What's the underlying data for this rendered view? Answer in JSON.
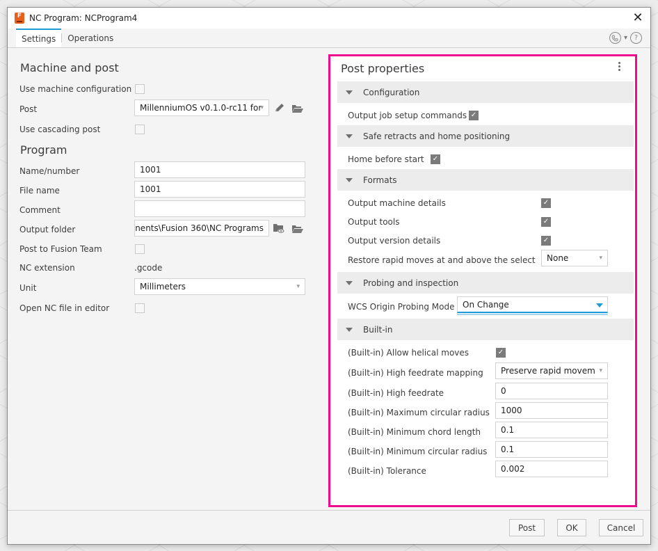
{
  "window": {
    "title": "NC Program: NCProgram4",
    "app_icon_letter": "F",
    "close_glyph": "✕"
  },
  "tabs": [
    {
      "label": "Settings",
      "active": true
    },
    {
      "label": "Operations",
      "active": false
    }
  ],
  "header_tools": {
    "contact_icon": "phone-icon",
    "chevron_glyph": "⌄",
    "help_glyph": "?"
  },
  "machine_and_post": {
    "title": "Machine and post",
    "use_machine_configuration": {
      "label": "Use machine configuration",
      "checked": false
    },
    "post": {
      "label": "Post",
      "value": "MillenniumOS v0.1.0-rc11 for"
    },
    "use_cascading_post": {
      "label": "Use cascading post",
      "checked": false
    }
  },
  "program": {
    "title": "Program",
    "name_number": {
      "label": "Name/number",
      "value": "1001"
    },
    "file_name": {
      "label": "File name",
      "value": "1001"
    },
    "comment": {
      "label": "Comment",
      "value": ""
    },
    "output_folder": {
      "label": "Output folder",
      "value": "nents\\Fusion 360\\NC Programs"
    },
    "post_to_fusion_team": {
      "label": "Post to Fusion Team",
      "checked": false
    },
    "nc_extension": {
      "label": "NC extension",
      "value": ".gcode"
    },
    "unit": {
      "label": "Unit",
      "value": "Millimeters"
    },
    "open_nc_file_in_editor": {
      "label": "Open NC file in editor",
      "checked": false
    }
  },
  "post_properties": {
    "title": "Post properties",
    "accent_color": "#ec0c8c",
    "groups": {
      "configuration": {
        "label": "Configuration",
        "output_job_setup_commands": {
          "label": "Output job setup commands",
          "checked": true
        }
      },
      "safe_retracts": {
        "label": "Safe retracts and home positioning",
        "home_before_start": {
          "label": "Home before start",
          "checked": true
        }
      },
      "formats": {
        "label": "Formats",
        "output_machine_details": {
          "label": "Output machine details",
          "checked": true
        },
        "output_tools": {
          "label": "Output tools",
          "checked": true
        },
        "output_version_details": {
          "label": "Output version details",
          "checked": true
        },
        "restore_rapid_moves": {
          "label": "Restore rapid moves at and above the selectec",
          "value": "None"
        }
      },
      "probing": {
        "label": "Probing and inspection",
        "wcs_origin_probing_mode": {
          "label": "WCS Origin Probing Mode",
          "value": "On Change"
        }
      },
      "builtin": {
        "label": "Built-in",
        "allow_helical_moves": {
          "label": "(Built-in) Allow helical moves",
          "checked": true
        },
        "high_feedrate_mapping": {
          "label": "(Built-in) High feedrate mapping",
          "value": "Preserve rapid movem"
        },
        "high_feedrate": {
          "label": "(Built-in) High feedrate",
          "value": "0"
        },
        "max_circular_radius": {
          "label": "(Built-in) Maximum circular radius",
          "value": "1000"
        },
        "min_chord_length": {
          "label": "(Built-in) Minimum chord length",
          "value": "0.1"
        },
        "min_circular_radius": {
          "label": "(Built-in) Minimum circular radius",
          "value": "0.1"
        },
        "tolerance": {
          "label": "(Built-in) Tolerance",
          "value": "0.002"
        }
      }
    }
  },
  "footer": {
    "post_label": "Post",
    "ok_label": "OK",
    "cancel_label": "Cancel"
  },
  "check_glyph": "✓"
}
